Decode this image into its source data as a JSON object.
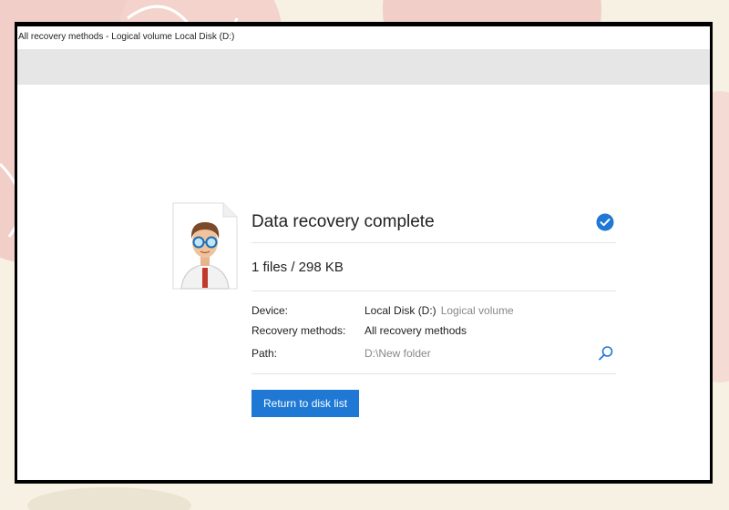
{
  "window": {
    "title": "All recovery methods - Logical volume Local Disk (D:)"
  },
  "result": {
    "heading": "Data recovery complete",
    "summary": "1 files / 298 KB",
    "device": {
      "label": "Device:",
      "value": "Local Disk (D:)",
      "subtitle": "Logical volume"
    },
    "methods": {
      "label": "Recovery methods:",
      "value": "All recovery methods"
    },
    "path": {
      "label": "Path:",
      "value": "D:\\New folder"
    },
    "return_button": "Return to disk list"
  },
  "colors": {
    "accent": "#1e78d4",
    "check": "#1e78d4",
    "background": "#f7f1e4",
    "deco_pink": "#f1cfc8"
  },
  "icons": [
    "doctor-avatar-icon",
    "check-icon",
    "search-icon"
  ]
}
